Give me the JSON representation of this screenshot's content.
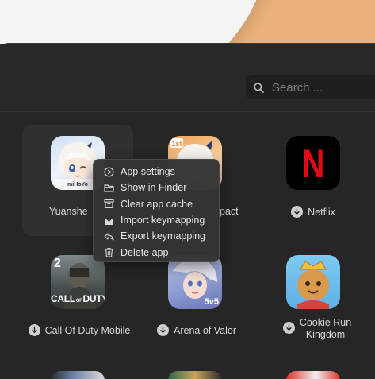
{
  "search": {
    "placeholder": "Search ..."
  },
  "apps": [
    {
      "label": "Yuanshe"
    },
    {
      "label": "pact"
    },
    {
      "label": "Netflix"
    },
    {
      "label": "Call Of Duty Mobile",
      "badge": "2"
    },
    {
      "label": "Arena of Valor",
      "badge": "5v5"
    },
    {
      "label_line1": "Cookie Run",
      "label_line2": "Kingdom"
    }
  ],
  "context_menu": {
    "items": [
      {
        "label": "App settings",
        "icon": "settings-icon"
      },
      {
        "label": "Show in Finder",
        "icon": "folder-icon"
      },
      {
        "label": "Clear app cache",
        "icon": "trash-box-icon"
      },
      {
        "label": "Import keymapping",
        "icon": "import-icon"
      },
      {
        "label": "Export keymapping",
        "icon": "export-icon"
      },
      {
        "label": "Delete app",
        "icon": "trash-icon"
      }
    ]
  },
  "icons": {
    "netflix_logo": "N",
    "cod_logo_line1": "CALL",
    "cod_logo_line2": "DUTY",
    "cod_logo_of": "OF",
    "genshin_brand": "miHoYo"
  },
  "colors": {
    "background": "#262626",
    "accent_orange": "#eab27a",
    "netflix_red": "#e50914"
  }
}
